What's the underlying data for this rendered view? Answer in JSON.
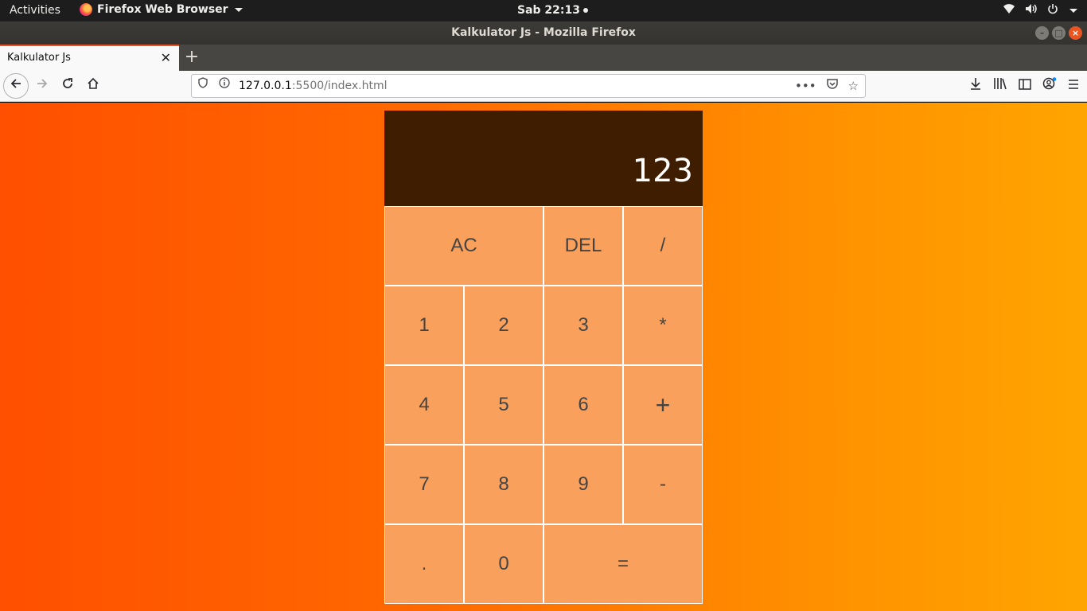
{
  "system": {
    "activities": "Activities",
    "app_name": "Firefox Web Browser",
    "clock": "Sab 22:13"
  },
  "window": {
    "title": "Kalkulator Js - Mozilla Firefox"
  },
  "tab": {
    "label": "Kalkulator Js",
    "close": "✕",
    "new_tab": "+"
  },
  "nav": {
    "url_host": "127.0.0.1",
    "url_rest": ":5500/index.html"
  },
  "calculator": {
    "previous_operand": "",
    "current_operand": "123",
    "keys": {
      "ac": "AC",
      "del": "DEL",
      "divide": "/",
      "one": "1",
      "two": "2",
      "three": "3",
      "multiply": "*",
      "four": "4",
      "five": "5",
      "six": "6",
      "plus": "+",
      "seven": "7",
      "eight": "8",
      "nine": "9",
      "minus": "-",
      "dot": ".",
      "zero": "0",
      "equals": "="
    }
  },
  "colors": {
    "display_bg": "#3f1d00",
    "key_bg": "#f9a05c",
    "gradient_start": "#ff4f00",
    "gradient_end": "#ffa500"
  }
}
